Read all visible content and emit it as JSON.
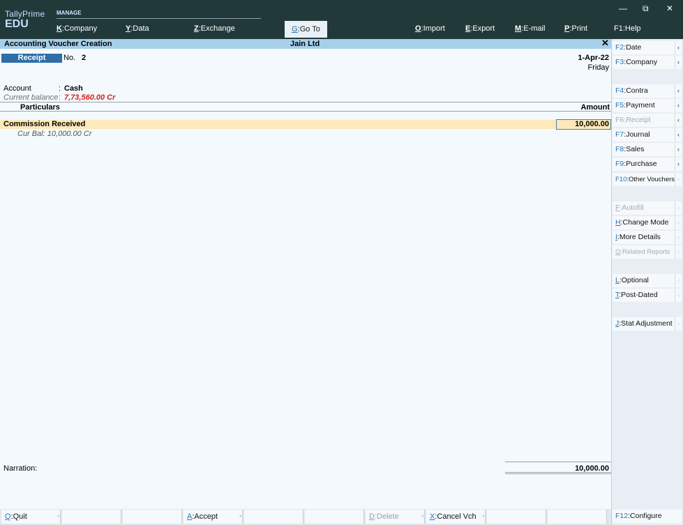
{
  "app": {
    "brand_line1": "TallyPrime",
    "brand_line2": "EDU",
    "section": "MANAGE",
    "window_controls": {
      "minimize": "—",
      "restore": "⧉",
      "close": "✕"
    }
  },
  "menu": [
    {
      "key": "K",
      "label": "Company"
    },
    {
      "key": "Y",
      "label": "Data"
    },
    {
      "key": "Z",
      "label": "Exchange"
    },
    {
      "key": "G",
      "label": "Go To"
    },
    {
      "key": "O",
      "label": "Import"
    },
    {
      "key": "E",
      "label": "Export"
    },
    {
      "key": "M",
      "label": "E-mail"
    },
    {
      "key": "P",
      "label": "Print"
    },
    {
      "key": "F1",
      "label": "Help"
    }
  ],
  "titlebar": {
    "title": "Accounting Voucher Creation",
    "company": "Jain Ltd",
    "close": "✕"
  },
  "voucher": {
    "type": "Receipt",
    "no_label": "No.",
    "no_value": "2",
    "date": "1-Apr-22",
    "day": "Friday",
    "account_label": "Account",
    "account_colon": ":",
    "account_value": "Cash",
    "balance_label": "Current balance",
    "balance_colon": ":",
    "balance_value": "7,73,560.00 Cr",
    "col_particulars": "Particulars",
    "col_amount": "Amount",
    "entry_name": "Commission Received",
    "entry_amount": "10,000.00",
    "entry_curbal": "Cur Bal:  10,000.00 Cr",
    "narration_label": "Narration:",
    "total": "10,000.00"
  },
  "bottom_buttons": [
    {
      "key": "Q",
      "label": "Quit",
      "enabled": true
    },
    {
      "key": "",
      "label": "",
      "enabled": false
    },
    {
      "key": "",
      "label": "",
      "enabled": false
    },
    {
      "key": "A",
      "label": "Accept",
      "enabled": true
    },
    {
      "key": "",
      "label": "",
      "enabled": false
    },
    {
      "key": "",
      "label": "",
      "enabled": false
    },
    {
      "key": "D",
      "label": "Delete",
      "enabled": false
    },
    {
      "key": "X",
      "label": "Cancel Vch",
      "enabled": true
    },
    {
      "key": "",
      "label": "",
      "enabled": false
    },
    {
      "key": "",
      "label": "",
      "enabled": false
    },
    {
      "key": "F12",
      "label": "Configure",
      "enabled": true
    }
  ],
  "right_panel": [
    {
      "key": "F2",
      "label": "Date",
      "enabled": true
    },
    {
      "key": "F3",
      "label": "Company",
      "enabled": true
    },
    {
      "key": "F4",
      "label": "Contra",
      "enabled": true
    },
    {
      "key": "F5",
      "label": "Payment",
      "enabled": true
    },
    {
      "key": "F6",
      "label": "Receipt",
      "enabled": false
    },
    {
      "key": "F7",
      "label": "Journal",
      "enabled": true
    },
    {
      "key": "F8",
      "label": "Sales",
      "enabled": true
    },
    {
      "key": "F9",
      "label": "Purchase",
      "enabled": true
    },
    {
      "key": "F10",
      "label": "Other Vouchers",
      "enabled": true
    },
    {
      "key": "F",
      "label": "Autofill",
      "enabled": false
    },
    {
      "key": "H",
      "label": "Change Mode",
      "enabled": true
    },
    {
      "key": "I",
      "label": "More Details",
      "enabled": true
    },
    {
      "key": "O",
      "label": "Related Reports",
      "enabled": false
    },
    {
      "key": "L",
      "label": "Optional",
      "enabled": true
    },
    {
      "key": "T",
      "label": "Post-Dated",
      "enabled": true
    },
    {
      "key": "J",
      "label": "Stat Adjustment",
      "enabled": true
    }
  ],
  "icons": {
    "chevron": "chevron-left-icon",
    "close": "close-icon"
  },
  "colors": {
    "topbar_bg": "#22393a",
    "titlebar_bg": "#a6cfea",
    "voucher_type_bg": "#2e6ea9",
    "highlight_row": "#fde9b9",
    "balance_red": "#d61f1f",
    "key_blue": "#2a73b3"
  }
}
